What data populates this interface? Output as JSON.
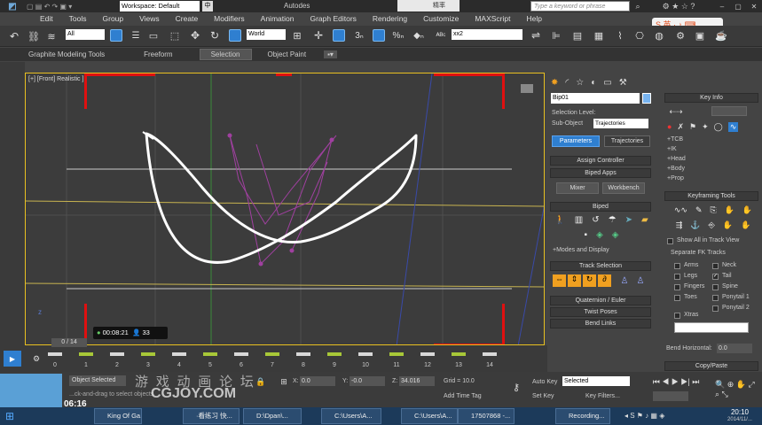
{
  "titlebar": {
    "workspace": "Workspace: Default",
    "app_title": "Autodes",
    "search_placeholder": "Type a keyword or phrase",
    "ime_text": "中",
    "ime_text2": "精率"
  },
  "menu": [
    "Edit",
    "Tools",
    "Group",
    "Views",
    "Create",
    "Modifiers",
    "Animation",
    "Graph Editors",
    "Rendering",
    "Customize",
    "MAXScript",
    "Help"
  ],
  "toolbar": {
    "filter": "All",
    "coord": "World",
    "named_sel": "xx2"
  },
  "ribbon_tabs": [
    "Graphite Modeling Tools",
    "Freeform",
    "Selection",
    "Object Paint"
  ],
  "viewport": {
    "label": "[+] [Front] Realistic ]",
    "recording_time": "00:08:21",
    "viewers": "33",
    "watermark": "游 戏 动 画 论 坛",
    "watermark2": "CGJOY.COM"
  },
  "cmdpanel": {
    "object_name": "Bip01",
    "selection_level": "Selection Level:",
    "sub_object": "Sub-Object",
    "sub_object_value": "Trajectories",
    "btn_parameters": "Parameters",
    "btn_trajectories": "Trajectories",
    "assign_controller": "Assign Controller",
    "biped_apps": "Biped Apps",
    "mixer": "Mixer",
    "workbench": "Workbench",
    "biped": "Biped",
    "modes_display": "+Modes and Display",
    "track_selection": "Track Selection",
    "quaternion": "Quaternion / Euler",
    "twist_poses": "Twist Poses",
    "bend_links": "Bend Links"
  },
  "rightpanel": {
    "key_info": "Key Info",
    "key_info_items": [
      "+TCB",
      "+IK",
      "+Head",
      "+Body",
      "+Prop"
    ],
    "keyframing_tools": "Keyframing Tools",
    "show_all": "Show All in Track View",
    "separate_fk": "Separate FK Tracks",
    "tracks_left": [
      "Arms",
      "Legs",
      "Fingers",
      "Toes"
    ],
    "tracks_right": [
      "Neck",
      "Tail",
      "Spine",
      "Ponytail 1",
      "Ponytail 2"
    ],
    "xtras": "Xtras",
    "bend_horizontal": "Bend Horizontal:",
    "bend_value": "0.0",
    "copy_paste": "Copy/Paste"
  },
  "timeline": {
    "frame_counter": "0 / 14",
    "ticks": [
      "0",
      "1",
      "2",
      "3",
      "4",
      "5",
      "6",
      "7",
      "8",
      "9",
      "10",
      "11",
      "12",
      "13",
      "14"
    ]
  },
  "status": {
    "left_tag": "Object Selected",
    "hint": "...ck-and-drag to select objects",
    "x_label": "X:",
    "x_value": "0.0",
    "y_label": "Y:",
    "y_value": "-0.0",
    "z_label": "Z:",
    "z_value": "34.016",
    "grid": "Grid = 10.0",
    "auto_key": "Auto Key",
    "auto_key_value": "Selected",
    "set_key": "Set Key",
    "key_filters": "Key Filters...",
    "add_time_tag": "Add Time Tag",
    "video_time": "06:16"
  },
  "taskbar": {
    "tasks": [
      "King Of Ga...",
      "·看练习 快...",
      "D:\\Dpan\\...",
      "C:\\Users\\A...",
      "C:\\Users\\A...",
      "17507868 -...",
      "Recording..."
    ],
    "clock": "20:10",
    "date": "2014/11/..."
  },
  "colors": {
    "accent": "#2f7fd0",
    "record_red": "#e01010",
    "viewport_border": "#e8c020",
    "path": "#ffffff"
  }
}
